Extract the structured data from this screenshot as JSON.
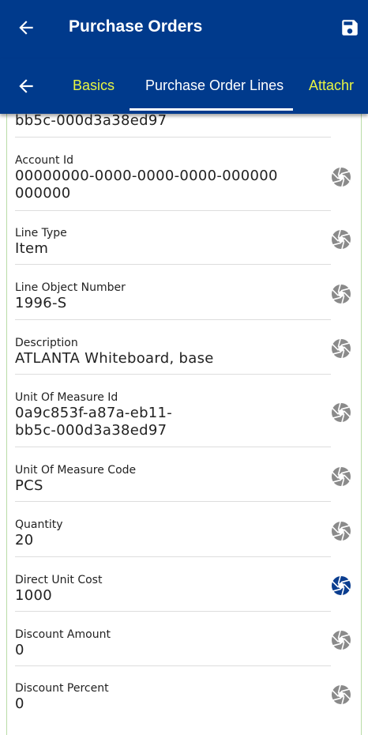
{
  "header": {
    "title": "Purchase Orders"
  },
  "tabs": [
    {
      "label": "Basics"
    },
    {
      "label": "Purchase Order Lines"
    },
    {
      "label": "Attachr"
    }
  ],
  "partial_value": "bb5c-000d3a38ed97",
  "fields": [
    {
      "label": "Account Id",
      "value_line1": "00000000-0000-0000-0000-000000",
      "value_line2": "000000",
      "icon_state": "inactive"
    },
    {
      "label": "Line Type",
      "value": "Item",
      "icon_state": "inactive"
    },
    {
      "label": "Line Object Number",
      "value": "1996-S",
      "icon_state": "inactive"
    },
    {
      "label": "Description",
      "value": "ATLANTA Whiteboard, base",
      "icon_state": "inactive"
    },
    {
      "label": "Unit Of Measure Id",
      "value_line1": "0a9c853f-a87a-eb11-",
      "value_line2": "bb5c-000d3a38ed97",
      "icon_state": "inactive"
    },
    {
      "label": "Unit Of Measure Code",
      "value": "PCS",
      "icon_state": "inactive"
    },
    {
      "label": "Quantity",
      "value": "20",
      "icon_state": "inactive"
    },
    {
      "label": "Direct Unit Cost",
      "value": "1000",
      "icon_state": "active"
    },
    {
      "label": "Discount Amount",
      "value": "0",
      "icon_state": "inactive"
    },
    {
      "label": "Discount Percent",
      "value": "0",
      "icon_state": "inactive"
    }
  ],
  "colors": {
    "appbar": "#003a8c",
    "tab_accent": "#e8f542",
    "icon_inactive": "#8a8a8a",
    "icon_active": "#0a3d8f"
  },
  "icons": {
    "back": "arrow-left-icon",
    "save": "floppy-disk-icon",
    "field_action": "aperture-icon"
  }
}
